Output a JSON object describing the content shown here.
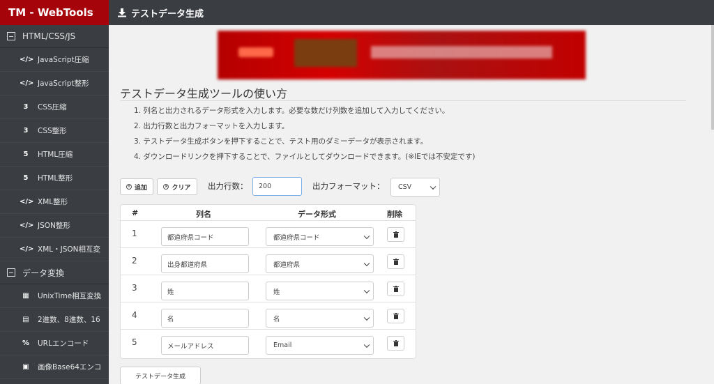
{
  "app": {
    "brand": "TM - WebTools",
    "page_title": "テストデータ生成"
  },
  "sidebar": {
    "sections": [
      {
        "label": "HTML/CSS/JS"
      },
      {
        "label": "データ変換"
      }
    ],
    "items": [
      {
        "icon": "code-icon",
        "glyph": "</>",
        "label": "JavaScript圧縮"
      },
      {
        "icon": "code-icon",
        "glyph": "</>",
        "label": "JavaScript整形"
      },
      {
        "icon": "css3-icon",
        "glyph": "3",
        "label": "CSS圧縮"
      },
      {
        "icon": "css3-icon",
        "glyph": "3",
        "label": "CSS整形"
      },
      {
        "icon": "html5-icon",
        "glyph": "5",
        "label": "HTML圧縮"
      },
      {
        "icon": "html5-icon",
        "glyph": "5",
        "label": "HTML整形"
      },
      {
        "icon": "code-icon",
        "glyph": "</>",
        "label": "XML整形"
      },
      {
        "icon": "code-icon",
        "glyph": "</>",
        "label": "JSON整形"
      },
      {
        "icon": "code-icon",
        "glyph": "</>",
        "label": "XML・JSON相互変"
      },
      {
        "icon": "calendar-icon",
        "glyph": "▦",
        "label": "UnixTime相互変換"
      },
      {
        "icon": "calculator-icon",
        "glyph": "▤",
        "label": "2進数、8進数、16"
      },
      {
        "icon": "percent-icon",
        "glyph": "%",
        "label": "URLエンコード"
      },
      {
        "icon": "image-file-icon",
        "glyph": "▣",
        "label": "画像Base64エンコ"
      }
    ]
  },
  "howto": {
    "title": "テストデータ生成ツールの使い方",
    "steps": [
      "1. 列名と出力されるデータ形式を入力します。必要な数だけ列数を追加して入力してください。",
      "2. 出力行数と出力フォーマットを入力します。",
      "3. テストデータ生成ボタンを押下することで、テスト用のダミーデータが表示されます。",
      "4. ダウンロードリンクを押下することで、ファイルとしてダウンロードできます。(※IEでは不安定です)"
    ]
  },
  "controls": {
    "add_label": "追加",
    "clear_label": "クリア",
    "rows_label": "出力行数：",
    "rows_value": "200",
    "format_label": "出力フォーマット：",
    "format_value": "CSV"
  },
  "table": {
    "headers": {
      "num": "#",
      "name": "列名",
      "type": "データ形式",
      "delete": "削除"
    },
    "rows": [
      {
        "num": "1",
        "name": "都道府県コード",
        "type": "都道府県コード"
      },
      {
        "num": "2",
        "name": "出身都道府県",
        "type": "都道府県"
      },
      {
        "num": "3",
        "name": "姓",
        "type": "姓"
      },
      {
        "num": "4",
        "name": "名",
        "type": "名"
      },
      {
        "num": "5",
        "name": "メールアドレス",
        "type": "Email"
      }
    ]
  },
  "generate_label": "テストデータ生成",
  "colors": {
    "brand": "#a6040b",
    "sidebar": "#3a3d42",
    "content_bg": "#f1f1f1"
  }
}
